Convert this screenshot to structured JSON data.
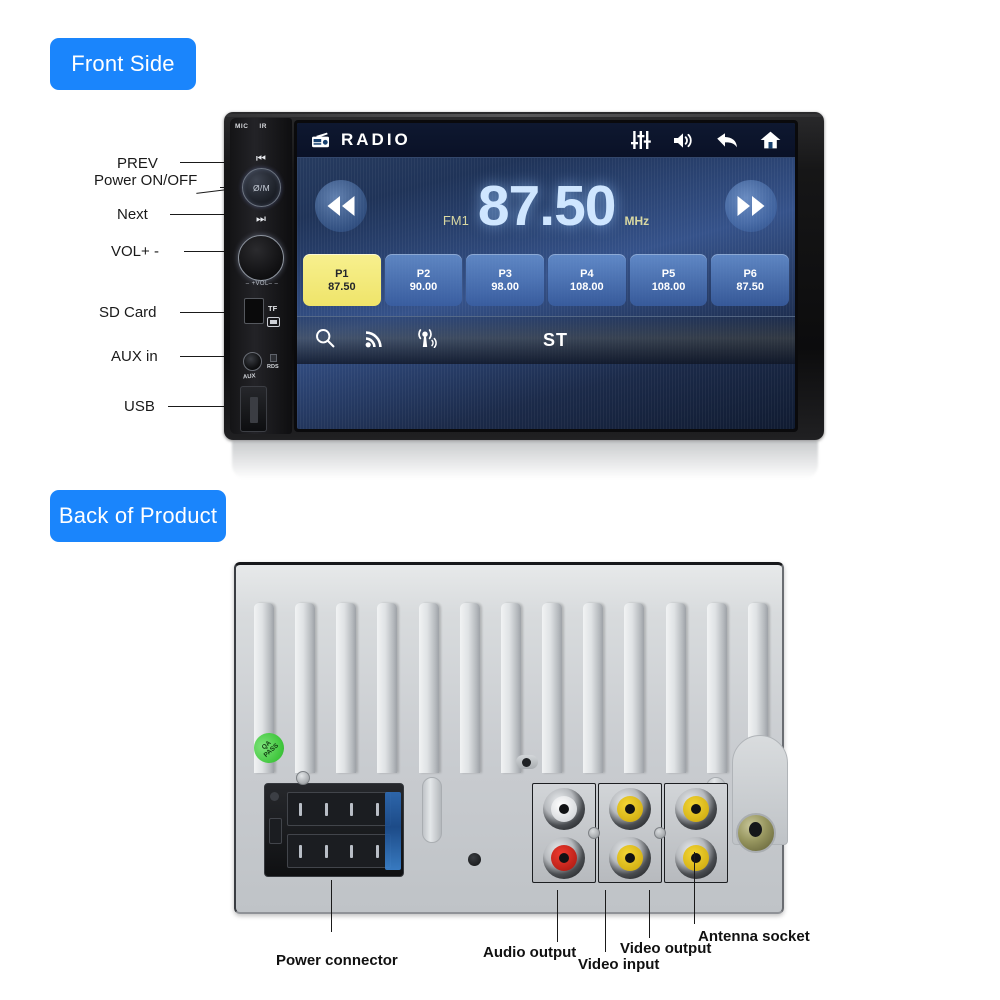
{
  "sections": {
    "front_badge": "Front Side",
    "back_badge": "Back of Product"
  },
  "front_view": {
    "bezel_markings": {
      "mic": "MIC",
      "ir": "IR"
    },
    "buttons": {
      "prev_glyph": "⏮",
      "power_label": "Ø/M",
      "next_glyph": "⏭",
      "vol_label": "– +VOL– –",
      "tf_label": "TF",
      "rds_label": "RDS",
      "aux_label": "AUX"
    },
    "callouts": [
      {
        "label": "PREV"
      },
      {
        "label": "Power ON/OFF"
      },
      {
        "label": "Next"
      },
      {
        "label": "VOL+ -"
      },
      {
        "label": "SD Card"
      },
      {
        "label": "AUX in"
      },
      {
        "label": "USB"
      }
    ]
  },
  "screen": {
    "topbar": {
      "title": "RADIO",
      "icons": [
        {
          "name": "radio-icon"
        },
        {
          "name": "equalizer-icon"
        },
        {
          "name": "volume-icon"
        },
        {
          "name": "back-arrow-icon"
        },
        {
          "name": "home-icon"
        }
      ]
    },
    "tuner": {
      "seek_down_glyph": "⏮",
      "seek_up_glyph": "⏭",
      "band": "FM1",
      "frequency": "87.50",
      "unit": "MHz"
    },
    "presets": [
      {
        "num": "P1",
        "freq": "87.50",
        "active": true
      },
      {
        "num": "P2",
        "freq": "90.00",
        "active": false
      },
      {
        "num": "P3",
        "freq": "98.00",
        "active": false
      },
      {
        "num": "P4",
        "freq": "108.00",
        "active": false
      },
      {
        "num": "P5",
        "freq": "108.00",
        "active": false
      },
      {
        "num": "P6",
        "freq": "87.50",
        "active": false
      }
    ],
    "bottombar": {
      "icons": [
        {
          "name": "search-icon"
        },
        {
          "name": "rss-signal-icon"
        },
        {
          "name": "broadcast-antenna-icon"
        }
      ],
      "stereo_label": "ST"
    },
    "colors": {
      "accent_yellow": "#efe46a",
      "band_text": "#d9d8a2",
      "frequency_text": "#cfe6ff",
      "preset_blue": "#6c98d8"
    }
  },
  "back_view": {
    "qa_sticker": {
      "line1": "QA",
      "line2": "PASS"
    },
    "callouts": [
      {
        "label": "Power connector"
      },
      {
        "label": "Audio output"
      },
      {
        "label": "Video input"
      },
      {
        "label": "Video output"
      },
      {
        "label": "Antenna socket"
      }
    ]
  },
  "theme": {
    "badge_blue": "#1a85fc",
    "page_background": "#ffffff",
    "label_text": "#1a1a1a"
  }
}
